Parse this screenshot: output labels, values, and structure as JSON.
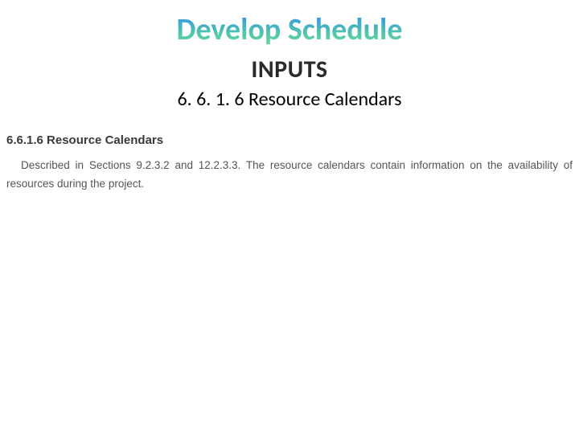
{
  "slide": {
    "title": "Develop Schedule",
    "subtitle": "INPUTS",
    "section_label": "6. 6. 1. 6 Resource Calendars"
  },
  "excerpt": {
    "heading": "6.6.1.6 Resource Calendars",
    "body": "Described in Sections 9.2.3.2 and 12.2.3.3. The resource calendars contain information on the availability of resources during the project."
  }
}
